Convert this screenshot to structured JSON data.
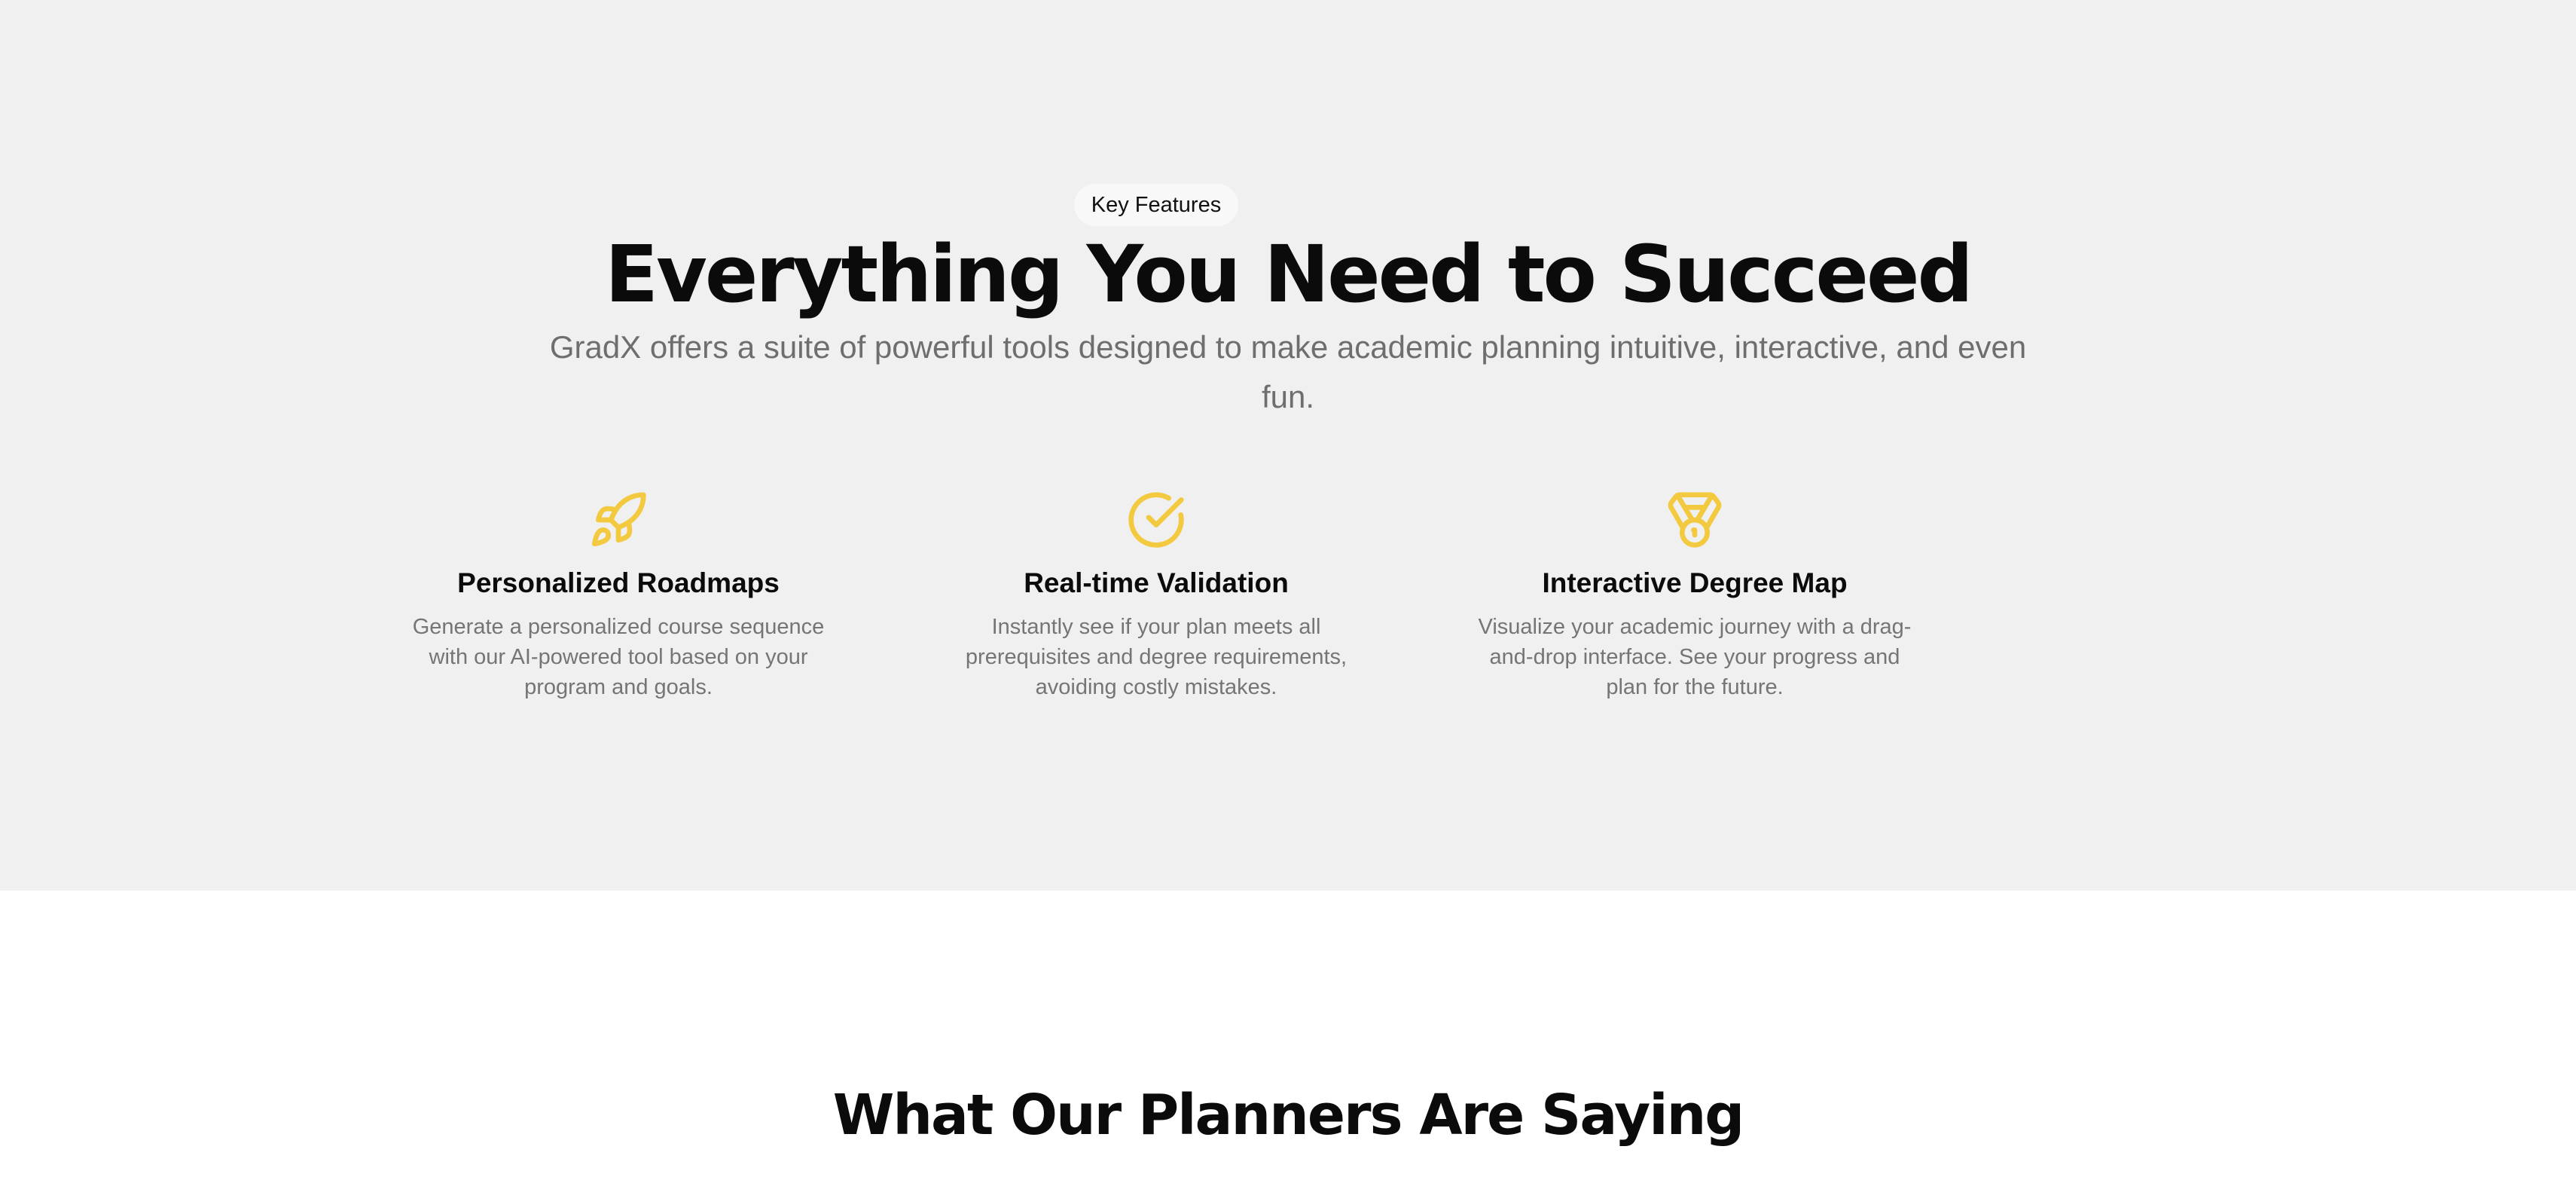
{
  "features_section": {
    "badge": "Key Features",
    "headline": "Everything You Need to Succeed",
    "subheadline": "GradX offers a suite of powerful tools designed to make academic planning intuitive, interactive, and even fun.",
    "accent_color": "#f3c93f",
    "background_color": "#f0f0f0",
    "items": [
      {
        "icon": "rocket-icon",
        "title": "Personalized Roadmaps",
        "description": "Generate a personalized course sequence with our AI-powered tool based on your program and goals."
      },
      {
        "icon": "check-circle-icon",
        "title": "Real-time Validation",
        "description": "Instantly see if your plan meets all prerequisites and degree requirements, avoiding costly mistakes."
      },
      {
        "icon": "medal-icon",
        "title": "Interactive Degree Map",
        "description": "Visualize your academic journey with a drag-and-drop interface. See your progress and plan for the future."
      }
    ]
  },
  "testimonials_section": {
    "title": "What Our Planners Are Saying"
  }
}
